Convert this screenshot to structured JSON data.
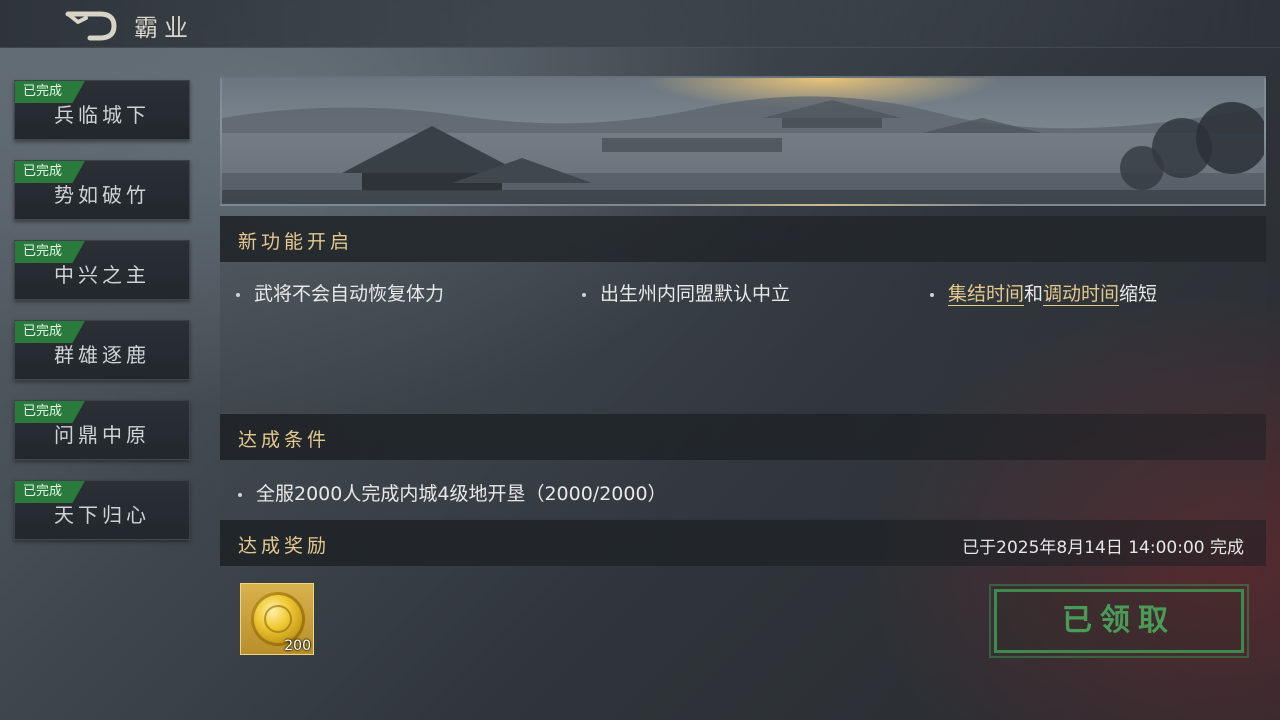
{
  "header": {
    "title": "霸业",
    "back_icon": "back-arrow-icon"
  },
  "sidebar": {
    "items": [
      {
        "label": "兵临城下",
        "status": "已完成"
      },
      {
        "label": "势如破竹",
        "status": "已完成"
      },
      {
        "label": "中兴之主",
        "status": "已完成"
      },
      {
        "label": "群雄逐鹿",
        "status": "已完成"
      },
      {
        "label": "问鼎中原",
        "status": "已完成"
      },
      {
        "label": "天下归心",
        "status": "已完成"
      }
    ],
    "badge_color": "#2a7a3e"
  },
  "features": {
    "title": "新功能开启",
    "items": [
      {
        "text": "武将不会自动恢复体力"
      },
      {
        "text": "出生州内同盟默认中立"
      },
      {
        "parts": [
          "集结时间",
          "和",
          "调动时间",
          "缩短"
        ]
      }
    ]
  },
  "conditions": {
    "title": "达成条件",
    "items": [
      {
        "text": "全服2000人完成内城4级地开垦（2000/2000）"
      }
    ]
  },
  "rewards": {
    "title": "达成奖励",
    "completed_at": "已于2025年8月14日 14:00:00 完成",
    "items": [
      {
        "icon": "gold-coin-icon",
        "quantity": "200"
      }
    ],
    "claimed_label": "已领取"
  },
  "colors": {
    "accent_gold": "#e3c88f",
    "claimed_green": "#3d8a4c"
  }
}
